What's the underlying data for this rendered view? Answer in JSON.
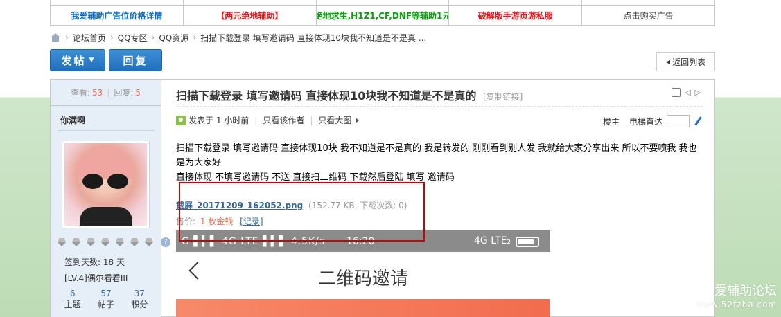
{
  "ads": [
    {
      "text": "我爱辅助广告位价格详情",
      "color": "#0b6bc9"
    },
    {
      "text": "【两元绝地辅助】",
      "color": "#e4171b"
    },
    {
      "text": "绝地求生,H1Z1,CF,DNF等辅助1元",
      "color": "#09a10b"
    },
    {
      "text": "破解版手游页游私服",
      "color": "#e4171b"
    },
    {
      "text": "点击购买广告",
      "color": "#333333"
    }
  ],
  "breadcrumb": [
    "论坛首页",
    "QQ专区",
    "QQ资源",
    "扫描下载登录 填写邀请码 直接体现10块我不知道是不是真 ..."
  ],
  "buttons": {
    "post": "发帖",
    "reply": "回复",
    "back": "返回列表"
  },
  "stats": {
    "views_label": "查看:",
    "views": "53",
    "replies_label": "回复:",
    "replies": "5"
  },
  "author": {
    "name": "你满啊",
    "signin": "签到天数: 18 天",
    "level": "[LV.4]偶尔看看III",
    "counts": [
      {
        "value": "6",
        "label": "主题"
      },
      {
        "value": "57",
        "label": "帖子"
      },
      {
        "value": "37",
        "label": "积分"
      }
    ]
  },
  "post": {
    "title": "扫描下载登录 填写邀请码 直接体现10块我不知道是不是真的",
    "copy_link": "[复制链接]",
    "posted": "发表于 1 小时前",
    "only_author": "只看该作者",
    "only_big": "只看大图",
    "floor": "楼主",
    "elevator": "电梯直达",
    "body_line1": "扫描下载登录 填写邀请码 直接体现10块     我不知道是不是真的  我是转发的 刚刚看到别人发  我就给大家分享出来   所以不要喷我 我也是为大家好",
    "body_line2": "直接体现   不填写邀请码 不送                直接扫二维码    下载然后登陆 填写 邀请码",
    "attachment_name": "截屏_20171209_162052.png",
    "attachment_info": "(152.77 KB, 下载次数: 0)",
    "price_label": "售价:",
    "price_value": "1 枚金钱",
    "record": "[记录]"
  },
  "screenshot": {
    "signal": "G ▌▍▌ 4G LTE ▌▍▌ 4.5K/s",
    "time": "16:20",
    "network": "4G LTE₂",
    "title": "二维码邀请"
  },
  "watermark": {
    "title": "爱辅助论坛",
    "url": "www.52fzba.com"
  }
}
